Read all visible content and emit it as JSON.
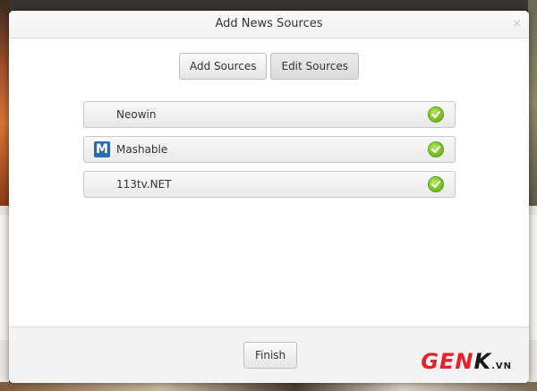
{
  "dialog": {
    "title": "Add News Sources",
    "close_glyph": "×"
  },
  "tabs": [
    {
      "label": "Add Sources",
      "active": false
    },
    {
      "label": "Edit Sources",
      "active": true
    }
  ],
  "sources": [
    {
      "name": "Neowin",
      "logo": "",
      "checked": true
    },
    {
      "name": "Mashable",
      "logo": "M",
      "checked": true
    },
    {
      "name": "113tv.NET",
      "logo": "",
      "checked": true
    }
  ],
  "footer": {
    "finish_label": "Finish"
  },
  "watermark": {
    "text_red": "GEN",
    "text_dark": "K",
    "suffix": ".VN"
  },
  "colors": {
    "check_green": "#7cc22a",
    "mashable_blue": "#2b6cb0",
    "watermark_red": "#e8202b"
  }
}
